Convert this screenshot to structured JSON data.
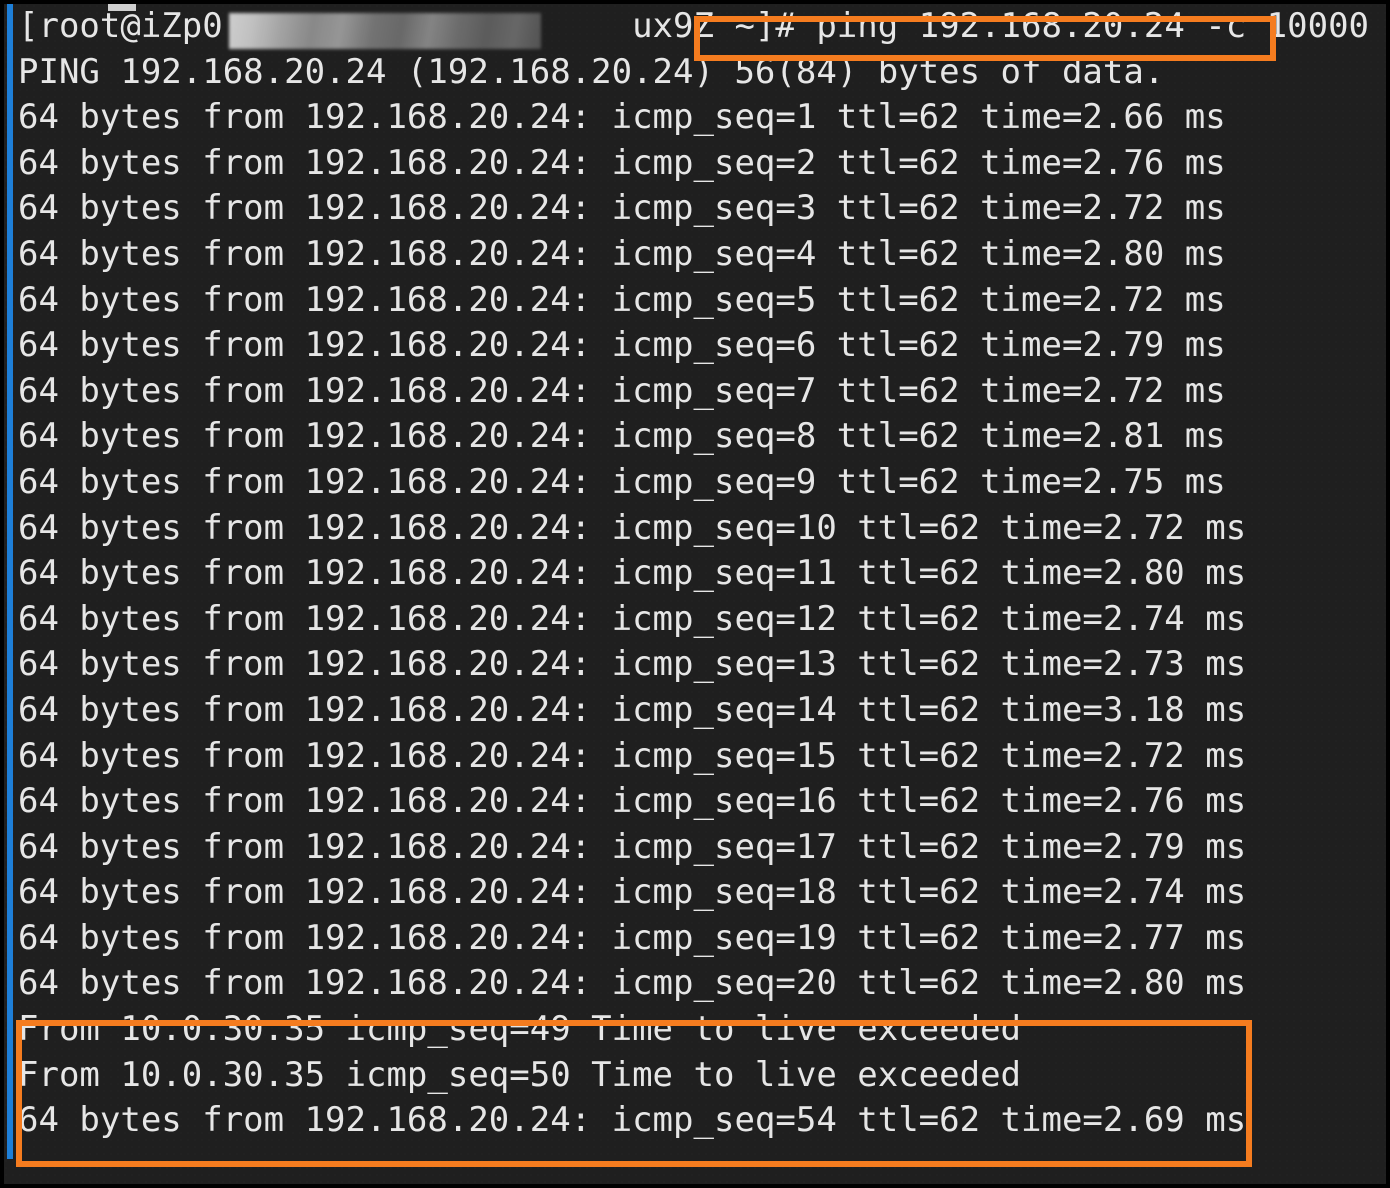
{
  "window": {
    "app": "terminal",
    "background_color": "#1f1f1f",
    "text_color": "#e6e6e6",
    "accent_color": "#f57c1f",
    "gutter_color": "#1e7fd8"
  },
  "prompt": {
    "user": "root",
    "host_prefix": "[root@iZp0",
    "host_redacted": true,
    "host_suffix": "ux9Z ~]#",
    "full_prompt": "[root@iZp0                    ux9Z ~]# ",
    "command": "ping 192.168.20.24 -c 10000"
  },
  "ping_header": "PING 192.168.20.24 (192.168.20.24) 56(84) bytes of data.",
  "target_ip": "192.168.20.24",
  "router_ip": "10.0.30.35",
  "replies": [
    {
      "text": "64 bytes from 192.168.20.24: icmp_seq=1 ttl=62 time=2.66 ms",
      "seq": 1,
      "ttl": 62,
      "time_ms": 2.66
    },
    {
      "text": "64 bytes from 192.168.20.24: icmp_seq=2 ttl=62 time=2.76 ms",
      "seq": 2,
      "ttl": 62,
      "time_ms": 2.76
    },
    {
      "text": "64 bytes from 192.168.20.24: icmp_seq=3 ttl=62 time=2.72 ms",
      "seq": 3,
      "ttl": 62,
      "time_ms": 2.72
    },
    {
      "text": "64 bytes from 192.168.20.24: icmp_seq=4 ttl=62 time=2.80 ms",
      "seq": 4,
      "ttl": 62,
      "time_ms": 2.8
    },
    {
      "text": "64 bytes from 192.168.20.24: icmp_seq=5 ttl=62 time=2.72 ms",
      "seq": 5,
      "ttl": 62,
      "time_ms": 2.72
    },
    {
      "text": "64 bytes from 192.168.20.24: icmp_seq=6 ttl=62 time=2.79 ms",
      "seq": 6,
      "ttl": 62,
      "time_ms": 2.79
    },
    {
      "text": "64 bytes from 192.168.20.24: icmp_seq=7 ttl=62 time=2.72 ms",
      "seq": 7,
      "ttl": 62,
      "time_ms": 2.72
    },
    {
      "text": "64 bytes from 192.168.20.24: icmp_seq=8 ttl=62 time=2.81 ms",
      "seq": 8,
      "ttl": 62,
      "time_ms": 2.81
    },
    {
      "text": "64 bytes from 192.168.20.24: icmp_seq=9 ttl=62 time=2.75 ms",
      "seq": 9,
      "ttl": 62,
      "time_ms": 2.75
    },
    {
      "text": "64 bytes from 192.168.20.24: icmp_seq=10 ttl=62 time=2.72 ms",
      "seq": 10,
      "ttl": 62,
      "time_ms": 2.72
    },
    {
      "text": "64 bytes from 192.168.20.24: icmp_seq=11 ttl=62 time=2.80 ms",
      "seq": 11,
      "ttl": 62,
      "time_ms": 2.8
    },
    {
      "text": "64 bytes from 192.168.20.24: icmp_seq=12 ttl=62 time=2.74 ms",
      "seq": 12,
      "ttl": 62,
      "time_ms": 2.74
    },
    {
      "text": "64 bytes from 192.168.20.24: icmp_seq=13 ttl=62 time=2.73 ms",
      "seq": 13,
      "ttl": 62,
      "time_ms": 2.73
    },
    {
      "text": "64 bytes from 192.168.20.24: icmp_seq=14 ttl=62 time=3.18 ms",
      "seq": 14,
      "ttl": 62,
      "time_ms": 3.18
    },
    {
      "text": "64 bytes from 192.168.20.24: icmp_seq=15 ttl=62 time=2.72 ms",
      "seq": 15,
      "ttl": 62,
      "time_ms": 2.72
    },
    {
      "text": "64 bytes from 192.168.20.24: icmp_seq=16 ttl=62 time=2.76 ms",
      "seq": 16,
      "ttl": 62,
      "time_ms": 2.76
    },
    {
      "text": "64 bytes from 192.168.20.24: icmp_seq=17 ttl=62 time=2.79 ms",
      "seq": 17,
      "ttl": 62,
      "time_ms": 2.79
    },
    {
      "text": "64 bytes from 192.168.20.24: icmp_seq=18 ttl=62 time=2.74 ms",
      "seq": 18,
      "ttl": 62,
      "time_ms": 2.74
    },
    {
      "text": "64 bytes from 192.168.20.24: icmp_seq=19 ttl=62 time=2.77 ms",
      "seq": 19,
      "ttl": 62,
      "time_ms": 2.77
    },
    {
      "text": "64 bytes from 192.168.20.24: icmp_seq=20 ttl=62 time=2.80 ms",
      "seq": 20,
      "ttl": 62,
      "time_ms": 2.8
    }
  ],
  "highlighted_block": {
    "lines": [
      {
        "text": "From 10.0.30.35 icmp_seq=49 Time to live exceeded",
        "seq": 49,
        "kind": "ttl-exceeded"
      },
      {
        "text": "From 10.0.30.35 icmp_seq=50 Time to live exceeded",
        "seq": 50,
        "kind": "ttl-exceeded"
      },
      {
        "text": "64 bytes from 192.168.20.24: icmp_seq=54 ttl=62 time=2.69 ms",
        "seq": 54,
        "ttl": 62,
        "time_ms": 2.69,
        "kind": "reply"
      }
    ]
  }
}
